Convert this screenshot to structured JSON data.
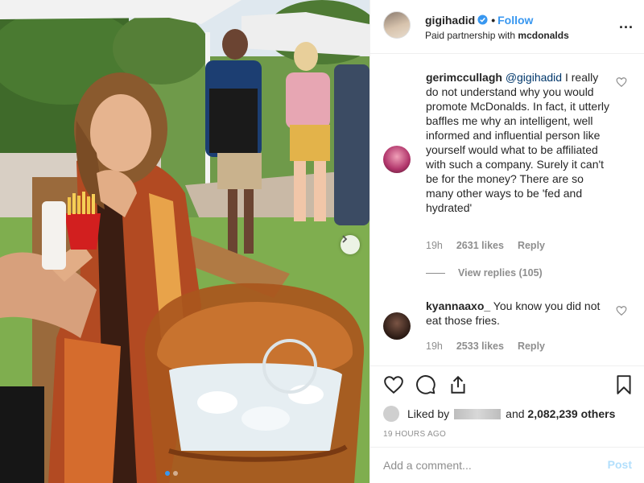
{
  "post": {
    "image_alt": "Woman in patterned dress holding fries beside ice bucket"
  },
  "header": {
    "username": "gigihadid",
    "separator": "•",
    "follow_label": "Follow",
    "subtitle_prefix": "Paid partnership with",
    "partner": "mcdonalds",
    "more_label": "..."
  },
  "comments": [
    {
      "username": "gerimccullagh",
      "mention": "@gigihadid",
      "text": " I really do not understand why you would promote McDonalds. In fact, it utterly baffles me why an intelligent, well informed and influential person like yourself would what to be affiliated with such a company. Surely it can't be for the money? There are so many other ways to be 'fed and hydrated'",
      "time": "19h",
      "likes": "2631 likes",
      "reply_label": "Reply",
      "view_replies": "View replies (105)"
    },
    {
      "username": "kyannaaxo_",
      "mention": "",
      "text": " You know you did not eat those fries.",
      "time": "19h",
      "likes": "2533 likes",
      "reply_label": "Reply"
    }
  ],
  "actions": {
    "liked_by_prefix": "Liked by",
    "liked_by_suffix": "and",
    "others": "2,082,239 others",
    "timestamp": "19 HOURS AGO"
  },
  "add_comment": {
    "placeholder": "Add a comment...",
    "post_label": "Post"
  },
  "colors": {
    "link_blue": "#3897f0",
    "post_disabled": "#b2dffc",
    "muted": "#8e8e8e"
  }
}
